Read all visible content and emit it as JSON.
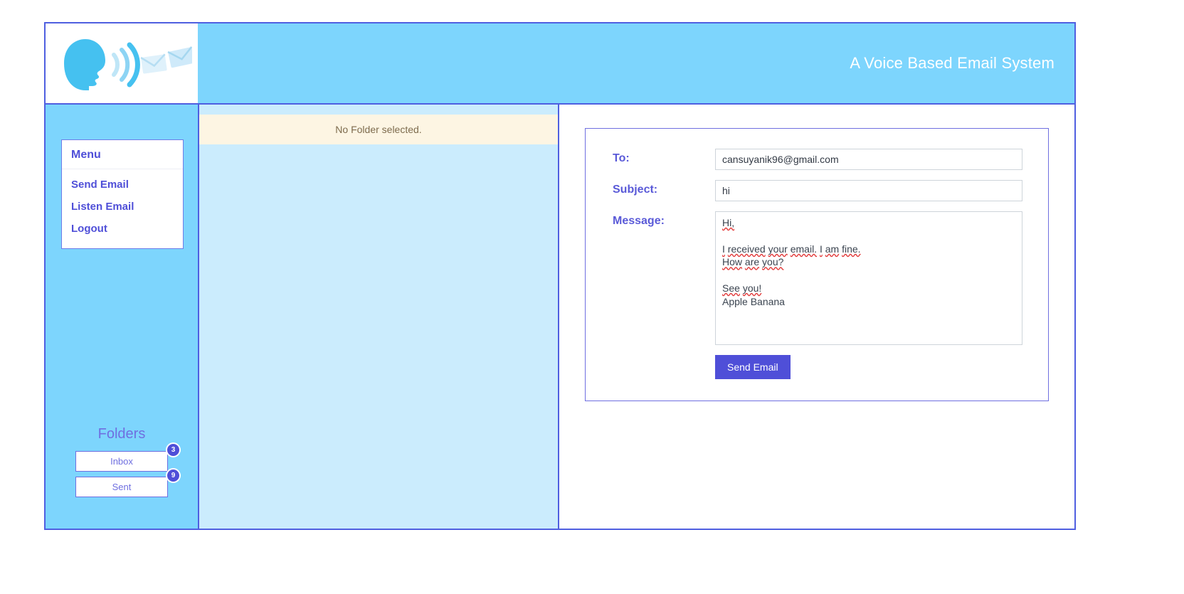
{
  "header": {
    "title": "A Voice Based Email System",
    "logo_alt": "voice-email-logo"
  },
  "sidebar": {
    "menu": {
      "heading": "Menu",
      "items": [
        {
          "label": "Send Email"
        },
        {
          "label": "Listen Email"
        },
        {
          "label": "Logout"
        }
      ]
    },
    "folders": {
      "title": "Folders",
      "items": [
        {
          "label": "Inbox",
          "badge": "3"
        },
        {
          "label": "Sent",
          "badge": "9"
        }
      ]
    }
  },
  "folder_pane": {
    "alert": "No Folder selected."
  },
  "compose": {
    "to_label": "To:",
    "to_value": "cansuyanik96@gmail.com",
    "to_placeholder": "To",
    "subject_label": "Subject:",
    "subject_value": "hi",
    "subject_placeholder": "Subject",
    "message_label": "Message:",
    "message_placeholder": "Message",
    "message_lines": [
      "Hi,",
      "",
      "I received your email. I am fine.",
      "How are you?",
      "",
      "See you!",
      "Apple Banana"
    ],
    "send_button": "Send Email"
  },
  "colors": {
    "header_bg": "#7dd5fd",
    "frame_border": "#4f5fe0",
    "accent": "#4f4fd8",
    "folder_pane_bg": "#cbecfd",
    "alert_bg": "#fdf5e3",
    "badge_bg": "#4f4fd8"
  }
}
